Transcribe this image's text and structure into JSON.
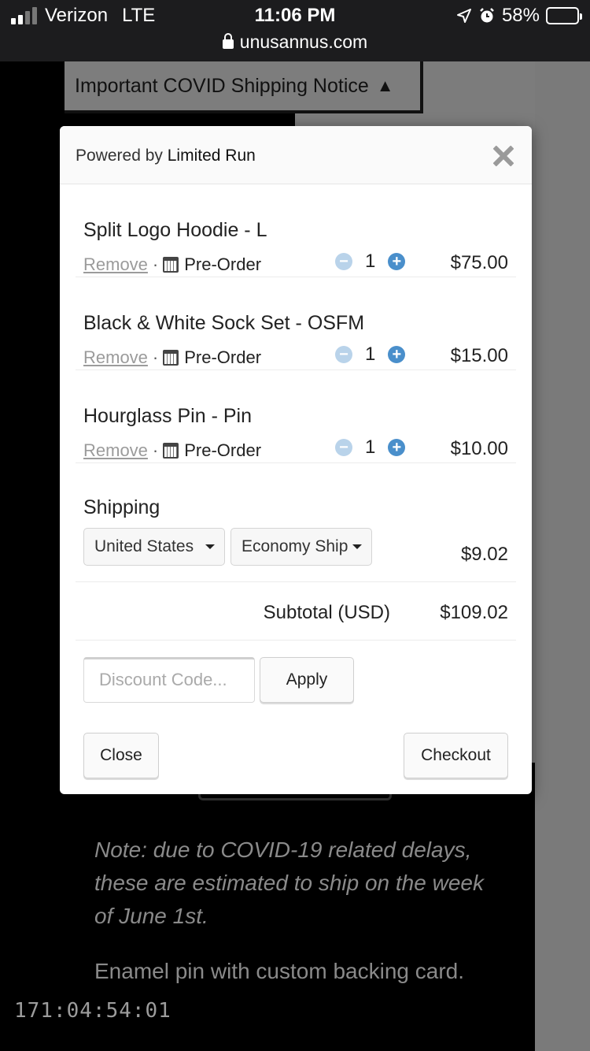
{
  "status_bar": {
    "carrier": "Verizon",
    "network": "LTE",
    "time": "11:06 PM",
    "battery": "58%",
    "battery_level": 0.58,
    "url": "unusannus.com"
  },
  "background": {
    "notice_label": "Important COVID Shipping Notice",
    "notice_arrow": "▲",
    "note": "Note: due to COVID-19 related delays, these are estimated to ship on the week of June 1st.",
    "description": "Enamel pin with custom backing card.",
    "timer": "171:04:54:01"
  },
  "modal": {
    "powered_by": "Powered by",
    "brand": "Limited Run",
    "items": [
      {
        "name": "Split Logo Hoodie - L",
        "remove": "Remove",
        "separator": "·",
        "status": "Pre-Order",
        "qty": "1",
        "price": "$75.00"
      },
      {
        "name": "Black & White Sock Set - OSFM",
        "remove": "Remove",
        "separator": "·",
        "status": "Pre-Order",
        "qty": "1",
        "price": "$15.00"
      },
      {
        "name": "Hourglass Pin - Pin",
        "remove": "Remove",
        "separator": "·",
        "status": "Pre-Order",
        "qty": "1",
        "price": "$10.00"
      }
    ],
    "shipping": {
      "title": "Shipping",
      "country": "United States",
      "method": "Economy Ship",
      "price": "$9.02"
    },
    "subtotal": {
      "label": "Subtotal (USD)",
      "value": "$109.02"
    },
    "discount_placeholder": "Discount Code...",
    "apply_label": "Apply",
    "close_label": "Close",
    "checkout_label": "Checkout"
  },
  "colors": {
    "qty_plus": "#4a8fcb",
    "qty_minus": "#b9d3ea",
    "battery": "#f3d12c"
  }
}
